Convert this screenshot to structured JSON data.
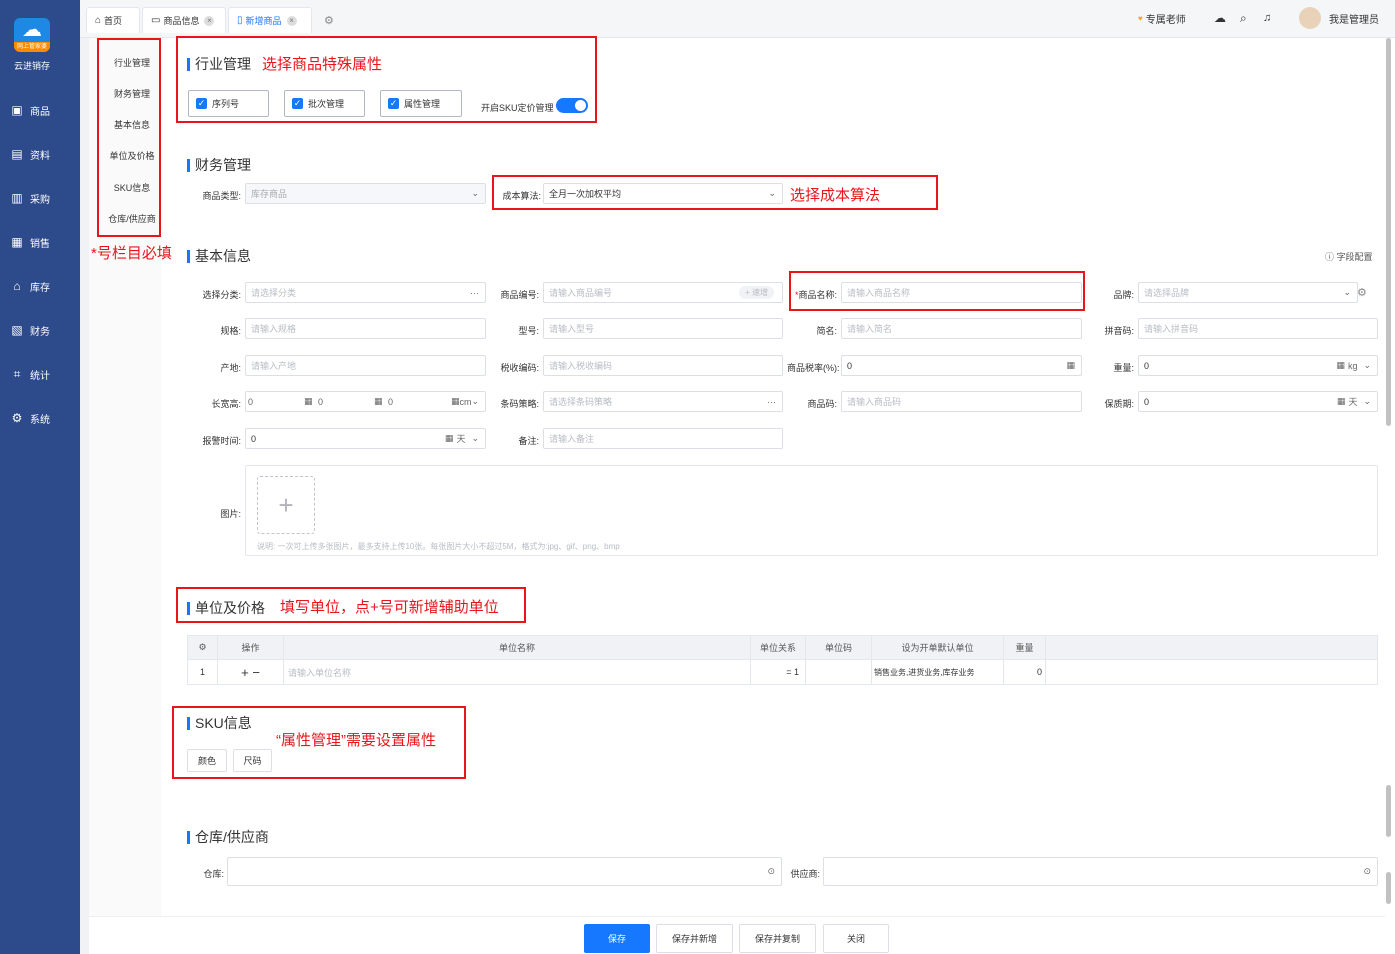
{
  "app": {
    "name": "云进销存",
    "logo_text": "网上管家婆"
  },
  "sidebar": {
    "items": [
      {
        "label": "商品",
        "icon": "bag-icon"
      },
      {
        "label": "资料",
        "icon": "doc-icon"
      },
      {
        "label": "采购",
        "icon": "purchase-icon"
      },
      {
        "label": "销售",
        "icon": "chart-icon"
      },
      {
        "label": "库存",
        "icon": "home-icon"
      },
      {
        "label": "财务",
        "icon": "finance-icon"
      },
      {
        "label": "统计",
        "icon": "stats-icon"
      },
      {
        "label": "系统",
        "icon": "gear-icon"
      }
    ]
  },
  "tabs": [
    {
      "label": "首页"
    },
    {
      "label": "商品信息"
    },
    {
      "label": "新增商品"
    }
  ],
  "header": {
    "teacher": "专属老师",
    "user": "我是管理员"
  },
  "subnav": [
    "行业管理",
    "财务管理",
    "基本信息",
    "单位及价格",
    "SKU信息",
    "仓库/供应商"
  ],
  "industry": {
    "title": "行业管理",
    "note": "选择商品特殊属性",
    "checks": [
      "序列号",
      "批次管理",
      "属性管理"
    ],
    "sku_toggle_label": "开启SKU定价管理",
    "sku_toggle_on": true
  },
  "finance": {
    "title": "财务管理",
    "type_label": "商品类型:",
    "type_value": "库存商品",
    "cost_label": "成本算法:",
    "cost_value": "全月一次加权平均",
    "note": "选择成本算法"
  },
  "required_note": "*号栏目必填",
  "basic": {
    "title": "基本信息",
    "field_config": "字段配置",
    "fields": {
      "category": {
        "label": "选择分类:",
        "placeholder": "请选择分类"
      },
      "code": {
        "label": "商品编号:",
        "placeholder": "请输入商品编号",
        "action": "+ 速增"
      },
      "name": {
        "label": "商品名称:",
        "placeholder": "请输入商品名称"
      },
      "brand": {
        "label": "品牌:",
        "placeholder": "请选择品牌"
      },
      "spec": {
        "label": "规格:",
        "placeholder": "请输入规格"
      },
      "model": {
        "label": "型号:",
        "placeholder": "请输入型号"
      },
      "short": {
        "label": "简名:",
        "placeholder": "请输入简名"
      },
      "pinyin": {
        "label": "拼音码:",
        "placeholder": "请输入拼音码"
      },
      "origin": {
        "label": "产地:",
        "placeholder": "请输入产地"
      },
      "taxcode": {
        "label": "税收编码:",
        "placeholder": "请输入税收编码"
      },
      "taxrate": {
        "label": "商品税率(%):",
        "value": "0"
      },
      "weight": {
        "label": "重量:",
        "value": "0",
        "unit": "kg"
      },
      "lwh": {
        "label": "长宽高:",
        "l": "0",
        "w": "0",
        "h": "0",
        "unit": "cm"
      },
      "barcode_policy": {
        "label": "条码策略:",
        "placeholder": "请选择条码策略"
      },
      "barcode": {
        "label": "商品码:",
        "placeholder": "请输入商品码"
      },
      "shelf": {
        "label": "保质期:",
        "value": "0",
        "unit": "天"
      },
      "alarm": {
        "label": "报警时间:",
        "value": "0",
        "unit": "天"
      },
      "remark": {
        "label": "备注:",
        "placeholder": "请输入备注"
      },
      "image": {
        "label": "图片:",
        "hint": "说明: 一次可上传多张图片，最多支持上传10张。每张图片大小不超过5M，格式为:jpg、gif、png、bmp"
      }
    }
  },
  "unit": {
    "title": "单位及价格",
    "note": "填写单位，点+号可新增辅助单位",
    "headers": [
      "操作",
      "单位名称",
      "单位关系",
      "单位码",
      "设为开单默认单位",
      "重量"
    ],
    "row": {
      "index": "1",
      "name_placeholder": "请输入单位名称",
      "relation": "= 1",
      "default_unit": "销售业务,进货业务,库存业务",
      "weight": "0"
    }
  },
  "sku": {
    "title": "SKU信息",
    "note": "“属性管理”需要设置属性",
    "buttons": [
      "颜色",
      "尺码"
    ]
  },
  "warehouse": {
    "title": "仓库/供应商",
    "wh_label": "仓库:",
    "supplier_label": "供应商:"
  },
  "footer": {
    "save": "保存",
    "save_new": "保存并新增",
    "save_copy": "保存并复制",
    "close": "关闭"
  },
  "colors": {
    "primary": "#1677ff",
    "sidebar": "#2d4a8a",
    "annotation": "#e8151b"
  }
}
